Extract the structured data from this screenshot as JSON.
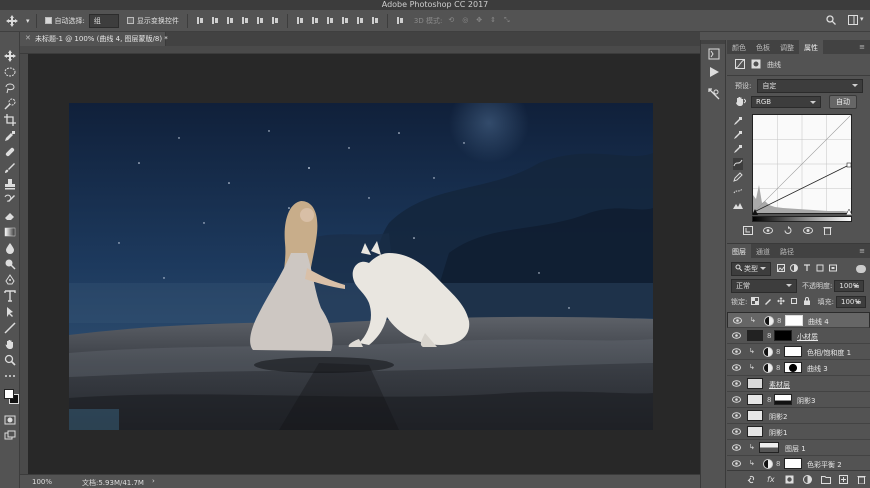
{
  "app": {
    "title": "Adobe Photoshop CC 2017"
  },
  "options_bar": {
    "auto_select_label": "自动选择:",
    "auto_select_value": "组",
    "show_transform_label": "显示变换控件",
    "mode_3d_label": "3D 模式:"
  },
  "document": {
    "tab_title": "未标题-1 @ 100% (曲线 4, 图层蒙版/8) *",
    "zoom": "100%",
    "doc_size": "文档:5.93M/41.7M"
  },
  "properties_panel": {
    "tabs": [
      "颜色",
      "色板",
      "调整",
      "属性"
    ],
    "active_tab": "属性",
    "adjustment_name": "曲线",
    "preset_label": "预设:",
    "preset_value": "自定",
    "channel_value": "RGB",
    "auto_button": "自动"
  },
  "layers_panel": {
    "tabs": [
      "图层",
      "通道",
      "路径"
    ],
    "active_tab": "图层",
    "filter_kind": "类型",
    "blend_mode": "正常",
    "opacity_label": "不透明度:",
    "opacity_value": "100%",
    "lock_label": "锁定:",
    "fill_label": "填充:",
    "fill_value": "100%",
    "layers": [
      {
        "name": "曲线 4",
        "selected": true
      },
      {
        "name": "小材质"
      },
      {
        "name": "色相/饱和度 1"
      },
      {
        "name": "曲线 3"
      },
      {
        "name": "素材层"
      },
      {
        "name": "阴影3"
      },
      {
        "name": "阴影2"
      },
      {
        "name": "阴影1"
      },
      {
        "name": "图层 1"
      },
      {
        "name": "色彩平衡 2"
      }
    ]
  },
  "colors": {
    "ui_bg": "#535353",
    "panel_dark": "#424242",
    "pasteboard": "#282828",
    "sky_top": "#14253f",
    "sky_bottom": "#2b4a6c"
  }
}
